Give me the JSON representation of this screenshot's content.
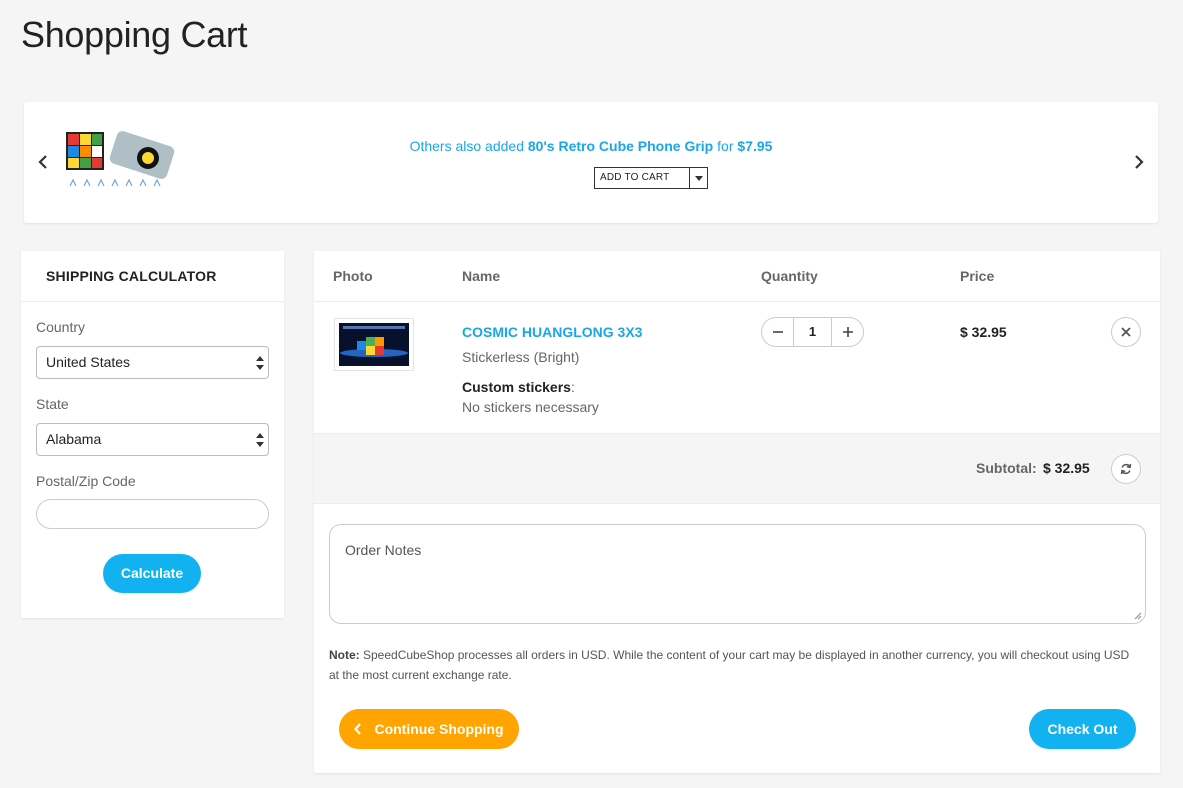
{
  "page": {
    "title": "Shopping Cart"
  },
  "upsell": {
    "prefix": "Others also added",
    "product": "80's Retro Cube Phone Grip",
    "connector": "for",
    "price": "$7.95",
    "add_button_label": "ADD TO CART",
    "prev_icon": "chevron-left-icon",
    "next_icon": "chevron-right-icon"
  },
  "shipping": {
    "title": "SHIPPING CALCULATOR",
    "country_label": "Country",
    "country_value": "United States",
    "state_label": "State",
    "state_value": "Alabama",
    "postal_label": "Postal/Zip Code",
    "postal_value": "",
    "calculate_label": "Calculate"
  },
  "cart": {
    "columns": [
      "Photo",
      "Name",
      "Quantity",
      "Price"
    ],
    "items": [
      {
        "name": "COSMIC HUANGLONG 3X3",
        "variant": "Stickerless (Bright)",
        "option_label": "Custom stickers",
        "option_value": "No stickers necessary",
        "quantity": "1",
        "price": "$ 32.95"
      }
    ],
    "subtotal_label": "Subtotal:",
    "subtotal_value": "$ 32.95",
    "notes_placeholder": "Order Notes",
    "note_bold": "Note:",
    "note_text": " SpeedCubeShop processes all orders in USD. While the content of your cart may be displayed in another currency, you will checkout using USD at the most current exchange rate.",
    "continue_label": "Continue Shopping",
    "checkout_label": "Check Out"
  },
  "colors": {
    "accent_blue": "#12b2f0",
    "link_blue": "#1aa6e8",
    "continue_orange": "#ffa400",
    "background": "#f5f5f5"
  }
}
